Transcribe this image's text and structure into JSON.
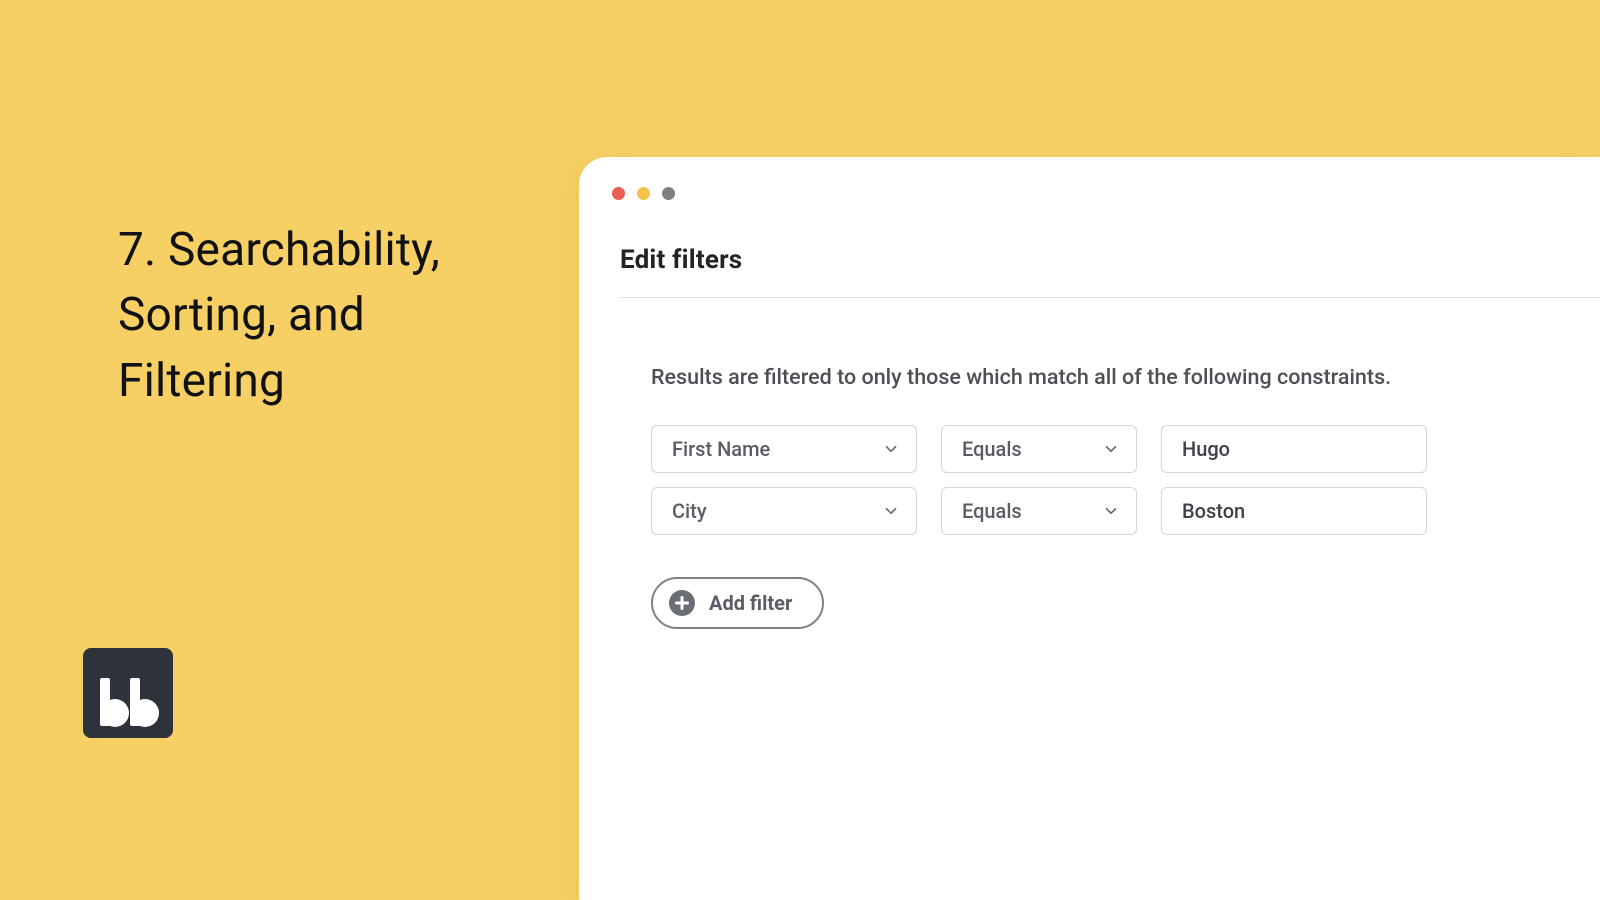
{
  "slide": {
    "title": "7. Searchability, Sorting, and Filtering",
    "logo_text": "bb"
  },
  "window": {
    "title": "Edit filters",
    "description": "Results are filtered to only those which match all of the following constraints.",
    "filters": [
      {
        "field": "First Name",
        "operator": "Equals",
        "value": "Hugo"
      },
      {
        "field": "City",
        "operator": "Equals",
        "value": "Boston"
      }
    ],
    "add_filter_label": "Add filter"
  }
}
